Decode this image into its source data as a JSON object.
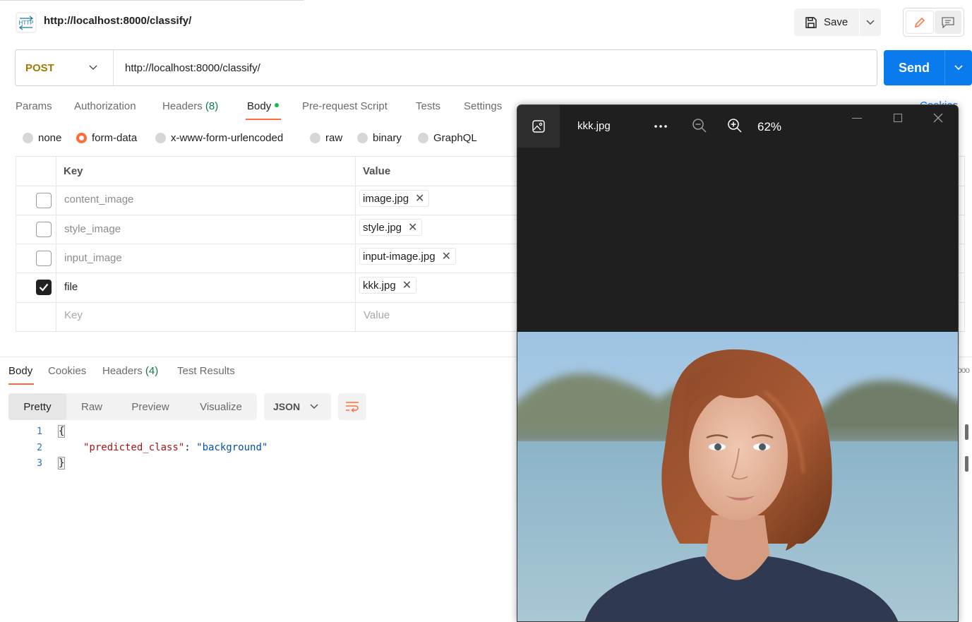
{
  "header": {
    "title": "http://localhost:8000/classify/",
    "save_label": "Save"
  },
  "request": {
    "method": "POST",
    "url": "http://localhost:8000/classify/",
    "send_label": "Send"
  },
  "request_tabs": {
    "params": "Params",
    "authorization": "Authorization",
    "headers": "Headers",
    "headers_count": "(8)",
    "body": "Body",
    "prerequest": "Pre-request Script",
    "tests": "Tests",
    "settings": "Settings",
    "cookies_partial": "Cookies"
  },
  "body_types": {
    "none": "none",
    "form_data": "form-data",
    "urlencoded": "x-www-form-urlencoded",
    "raw": "raw",
    "binary": "binary",
    "graphql": "GraphQL",
    "selected": "form-data"
  },
  "form_table": {
    "key_header": "Key",
    "value_header": "Value",
    "rows": [
      {
        "key": "content_image",
        "value": "image.jpg",
        "checked": false
      },
      {
        "key": "style_image",
        "value": "style.jpg",
        "checked": false
      },
      {
        "key": "input_image",
        "value": "input-image.jpg",
        "checked": false
      },
      {
        "key": "file",
        "value": "kkk.jpg",
        "checked": true
      }
    ],
    "key_placeholder": "Key",
    "value_placeholder": "Value",
    "remove_glyph": "✕"
  },
  "response": {
    "tabs": {
      "body": "Body",
      "cookies": "Cookies",
      "headers": "Headers",
      "headers_count": "(4)",
      "test_results": "Test Results"
    },
    "formats": {
      "pretty": "Pretty",
      "raw": "Raw",
      "preview": "Preview",
      "visualize": "Visualize"
    },
    "language": "JSON",
    "lines": [
      "1",
      "2",
      "3"
    ],
    "code": {
      "open_brace": "{",
      "key": "\"predicted_class\"",
      "colon": ": ",
      "value": "\"background\"",
      "close_brace": "}"
    }
  },
  "viewer": {
    "title": "kkk.jpg",
    "zoom": "62%"
  },
  "colors": {
    "accent_orange": "#ff6c37",
    "send_blue": "#097bed",
    "method_yellow": "#a37a00",
    "count_green": "#0c7a43",
    "viewer_bg": "#1f1f1f"
  },
  "icons": [
    "http-icon",
    "save-icon",
    "chevron-down-icon",
    "pencil-icon",
    "comment-icon",
    "check-icon",
    "wrap-lines-icon",
    "gallery-icon",
    "more-icon",
    "zoom-out-icon",
    "zoom-in-icon",
    "minimize-icon",
    "maximize-icon",
    "close-icon"
  ]
}
